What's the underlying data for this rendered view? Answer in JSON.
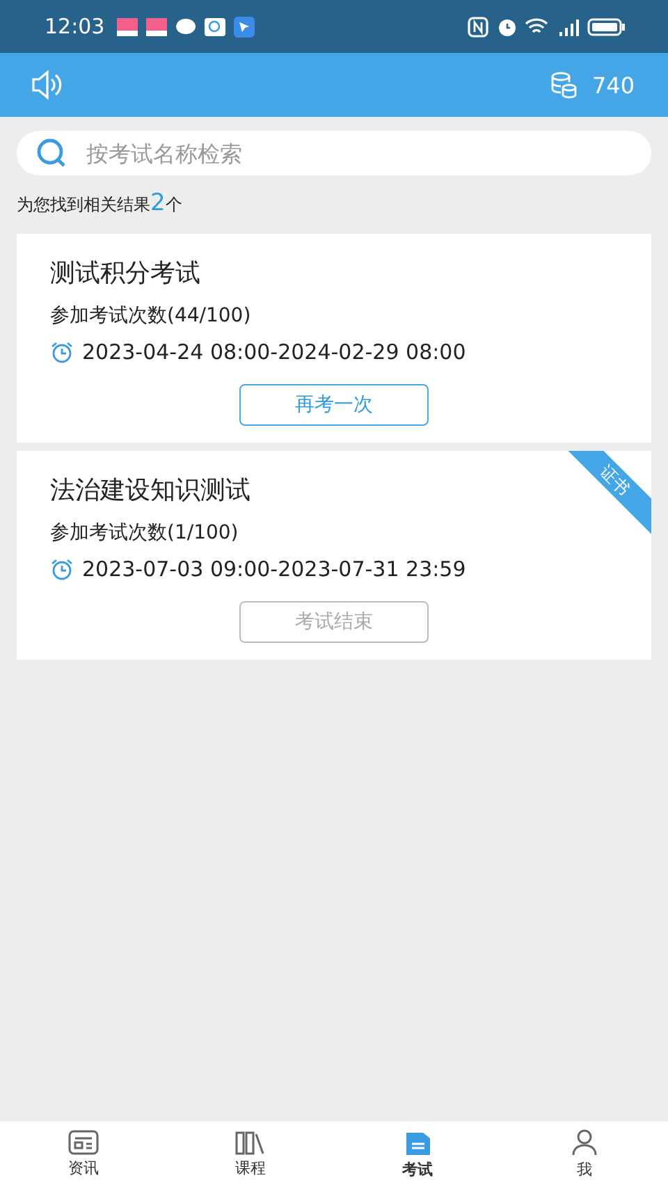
{
  "status_bar": {
    "time": "12:03"
  },
  "header": {
    "coins": "740"
  },
  "search": {
    "placeholder": "按考试名称检索"
  },
  "summary": {
    "prefix": "为您找到相关结果",
    "count": "2",
    "suffix": "个"
  },
  "exams": [
    {
      "title": "测试积分考试",
      "attempts": "参加考试次数(44/100)",
      "period": "2023-04-24 08:00-2024-02-29 08:00",
      "action": "再考一次",
      "disabled": false
    },
    {
      "title": "法治建设知识测试",
      "attempts": "参加考试次数(1/100)",
      "period": "2023-07-03 09:00-2023-07-31 23:59",
      "action": "考试结束",
      "disabled": true,
      "badge": "证书"
    }
  ],
  "tab_bar": [
    {
      "label": "资讯",
      "kind": "news",
      "selected": false
    },
    {
      "label": "课程",
      "kind": "courses",
      "selected": false
    },
    {
      "label": "考试",
      "kind": "exams",
      "selected": true
    },
    {
      "label": "我",
      "kind": "me",
      "selected": false
    }
  ]
}
